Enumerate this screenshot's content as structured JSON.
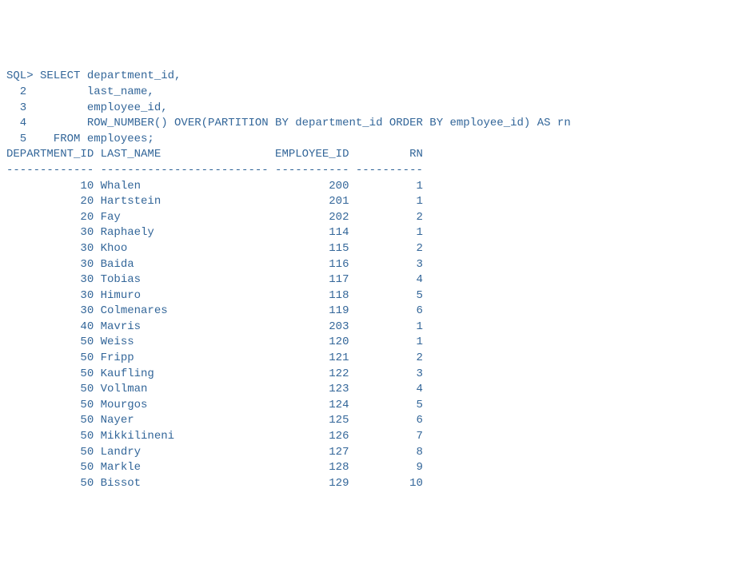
{
  "prompt": "SQL> ",
  "query_lines": [
    {
      "num": "",
      "text": "SELECT department_id,"
    },
    {
      "num": "2",
      "text": "       last_name,"
    },
    {
      "num": "3",
      "text": "       employee_id,"
    },
    {
      "num": "4",
      "text": "       ROW_NUMBER() OVER(PARTITION BY department_id ORDER BY employee_id) AS rn"
    },
    {
      "num": "5",
      "text": "  FROM employees;"
    }
  ],
  "headers": {
    "department_id": "DEPARTMENT_ID",
    "last_name": "LAST_NAME",
    "employee_id": "EMPLOYEE_ID",
    "rn": "RN"
  },
  "separator": {
    "department_id": "-------------",
    "last_name": "-------------------------",
    "employee_id": "-----------",
    "rn": "----------"
  },
  "rows": [
    {
      "department_id": "10",
      "last_name": "Whalen",
      "employee_id": "200",
      "rn": "1"
    },
    {
      "department_id": "20",
      "last_name": "Hartstein",
      "employee_id": "201",
      "rn": "1"
    },
    {
      "department_id": "20",
      "last_name": "Fay",
      "employee_id": "202",
      "rn": "2"
    },
    {
      "department_id": "30",
      "last_name": "Raphaely",
      "employee_id": "114",
      "rn": "1"
    },
    {
      "department_id": "30",
      "last_name": "Khoo",
      "employee_id": "115",
      "rn": "2"
    },
    {
      "department_id": "30",
      "last_name": "Baida",
      "employee_id": "116",
      "rn": "3"
    },
    {
      "department_id": "30",
      "last_name": "Tobias",
      "employee_id": "117",
      "rn": "4"
    },
    {
      "department_id": "30",
      "last_name": "Himuro",
      "employee_id": "118",
      "rn": "5"
    },
    {
      "department_id": "30",
      "last_name": "Colmenares",
      "employee_id": "119",
      "rn": "6"
    },
    {
      "department_id": "40",
      "last_name": "Mavris",
      "employee_id": "203",
      "rn": "1"
    },
    {
      "department_id": "50",
      "last_name": "Weiss",
      "employee_id": "120",
      "rn": "1"
    },
    {
      "department_id": "50",
      "last_name": "Fripp",
      "employee_id": "121",
      "rn": "2"
    },
    {
      "department_id": "50",
      "last_name": "Kaufling",
      "employee_id": "122",
      "rn": "3"
    },
    {
      "department_id": "50",
      "last_name": "Vollman",
      "employee_id": "123",
      "rn": "4"
    },
    {
      "department_id": "50",
      "last_name": "Mourgos",
      "employee_id": "124",
      "rn": "5"
    },
    {
      "department_id": "50",
      "last_name": "Nayer",
      "employee_id": "125",
      "rn": "6"
    },
    {
      "department_id": "50",
      "last_name": "Mikkilineni",
      "employee_id": "126",
      "rn": "7"
    },
    {
      "department_id": "50",
      "last_name": "Landry",
      "employee_id": "127",
      "rn": "8"
    },
    {
      "department_id": "50",
      "last_name": "Markle",
      "employee_id": "128",
      "rn": "9"
    },
    {
      "department_id": "50",
      "last_name": "Bissot",
      "employee_id": "129",
      "rn": "10"
    }
  ]
}
